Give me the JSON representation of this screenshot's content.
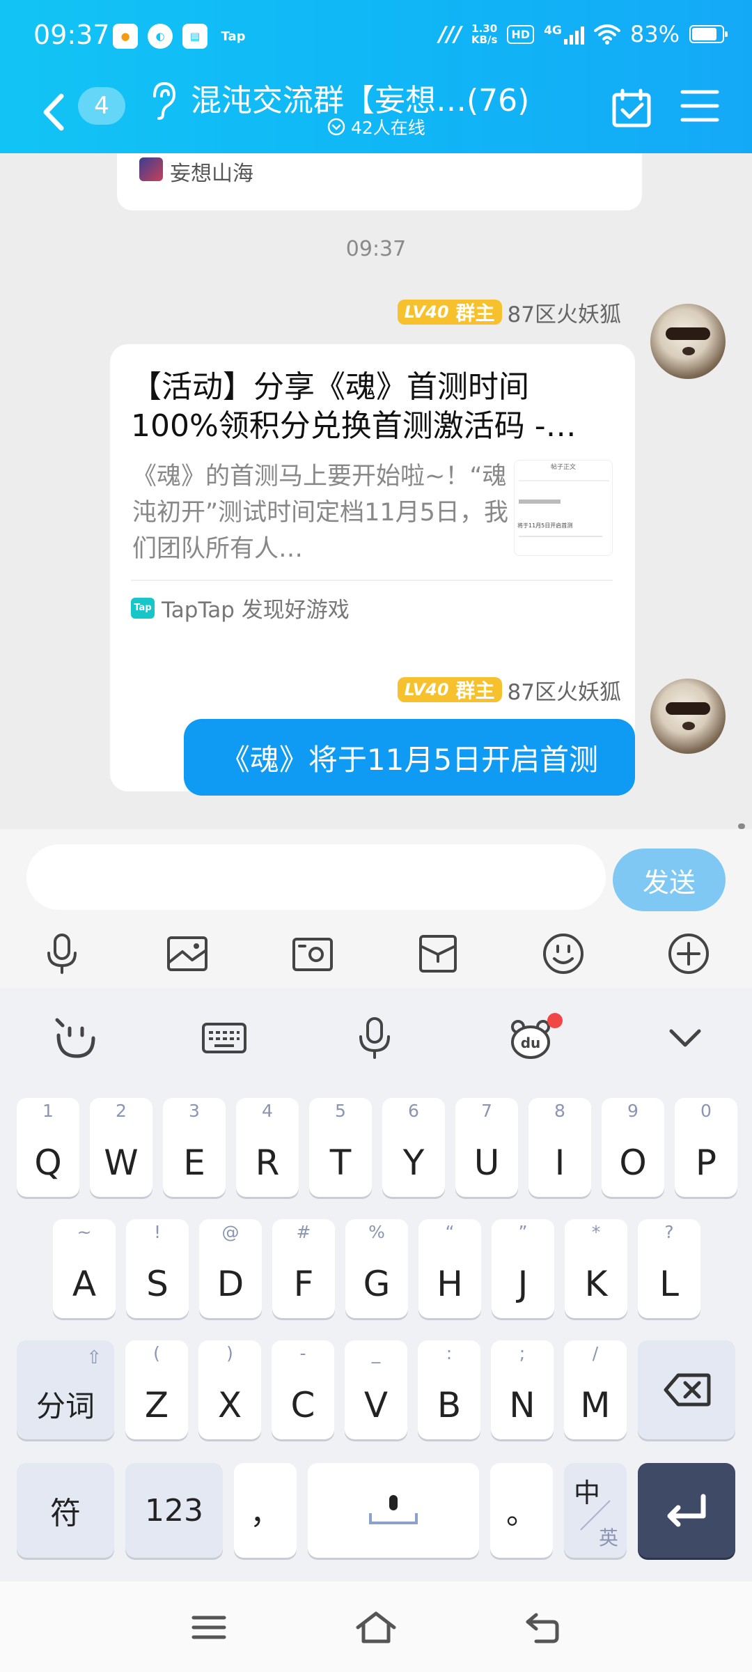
{
  "status_bar": {
    "time": "09:37",
    "app_icons": [
      "app-icon-1",
      "app-icon-2",
      "app-icon-3",
      "Tap"
    ],
    "network_speed_value": "1.30",
    "network_speed_unit": "KB/s",
    "hd_label": "HD",
    "network_type": "4G",
    "battery": "83%",
    "battery_level": 0.83
  },
  "header": {
    "unread_count": "4",
    "group_title": "混沌交流群【妄想…(76)",
    "online_text": "42人在线"
  },
  "chat": {
    "previous_card_source": "妄想山海",
    "time_divider": "09:37",
    "messages": [
      {
        "level_badge": "LV40",
        "role_badge": "群主",
        "sender": "87区火妖狐",
        "card": {
          "title": "【活动】分享《魂》首测时间100%领积分兑换首测激活码 -…",
          "description": "《魂》的首测马上要开始啦~！“魂沌初开”测试时间定档11月5日，我们团队所有人…",
          "thumbnail_heading": "帖子正文",
          "thumbnail_line": "将于11月5日开启首测",
          "source_logo": "Tap",
          "source": "TapTap 发现好游戏"
        }
      },
      {
        "level_badge": "LV40",
        "role_badge": "群主",
        "sender": "87区火妖狐",
        "text": "《魂》将于11月5日开启首测"
      }
    ]
  },
  "input": {
    "value": "",
    "placeholder": "",
    "send_label": "发送"
  },
  "keyboard": {
    "row1": [
      {
        "sub": "1",
        "main": "Q"
      },
      {
        "sub": "2",
        "main": "W"
      },
      {
        "sub": "3",
        "main": "E"
      },
      {
        "sub": "4",
        "main": "R"
      },
      {
        "sub": "5",
        "main": "T"
      },
      {
        "sub": "6",
        "main": "Y"
      },
      {
        "sub": "7",
        "main": "U"
      },
      {
        "sub": "8",
        "main": "I"
      },
      {
        "sub": "9",
        "main": "O"
      },
      {
        "sub": "0",
        "main": "P"
      }
    ],
    "row2": [
      {
        "sub": "~",
        "main": "A"
      },
      {
        "sub": "!",
        "main": "S"
      },
      {
        "sub": "@",
        "main": "D"
      },
      {
        "sub": "#",
        "main": "F"
      },
      {
        "sub": "%",
        "main": "G"
      },
      {
        "sub": "“",
        "main": "H"
      },
      {
        "sub": "”",
        "main": "J"
      },
      {
        "sub": "*",
        "main": "K"
      },
      {
        "sub": "?",
        "main": "L"
      }
    ],
    "row3": [
      {
        "sub": "(",
        "main": "Z"
      },
      {
        "sub": ")",
        "main": "X"
      },
      {
        "sub": "-",
        "main": "C"
      },
      {
        "sub": "_",
        "main": "V"
      },
      {
        "sub": ":",
        "main": "B"
      },
      {
        "sub": ";",
        "main": "N"
      },
      {
        "sub": "/",
        "main": "M"
      }
    ],
    "segment_key": "分词",
    "symbol_key": "符",
    "numeric_key": "123",
    "comma_key": "，",
    "period_key": "。",
    "lang_cn": "中",
    "lang_en": "英"
  }
}
